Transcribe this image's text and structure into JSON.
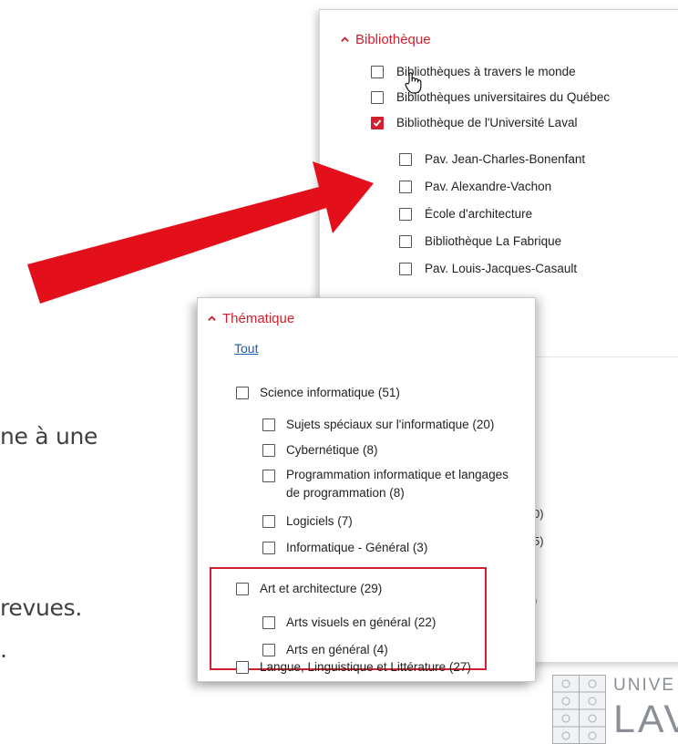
{
  "background_text": {
    "line1": "ne à une",
    "line2": "revues.",
    "line3": "."
  },
  "bibliotheque": {
    "title": "Bibliothèque",
    "items": [
      {
        "label": "Bibliothèques à travers le monde",
        "checked": false
      },
      {
        "label": "Bibliothèques universitaires du Québec",
        "checked": false
      },
      {
        "label": "Bibliothèque de l'Université Laval",
        "checked": true
      }
    ],
    "subitems": [
      {
        "label": "Pav. Jean-Charles-Bonenfant",
        "checked": false
      },
      {
        "label": "Pav. Alexandre-Vachon",
        "checked": false
      },
      {
        "label": "École d'architecture",
        "checked": false
      },
      {
        "label": "Bibliothèque La Fabrique",
        "checked": false
      },
      {
        "label": "Pav. Louis-Jacques-Casault",
        "checked": false
      }
    ],
    "hidden_counts": [
      "0)",
      "5)",
      ")"
    ]
  },
  "thematique": {
    "title": "Thématique",
    "all_link": "Tout",
    "groups": [
      {
        "label": "Science informatique (51)",
        "children": [
          "Sujets spéciaux sur l'informatique (20)",
          "Cybernétique (8)",
          "Programmation informatique et langages de programmation (8)",
          "Logiciels (7)",
          "Informatique - Général (3)"
        ]
      },
      {
        "label": "Art et architecture (29)",
        "children": [
          "Arts visuels en général (22)",
          "Arts en général (4)"
        ]
      },
      {
        "label": "Langue, Linguistique et Littérature (27)",
        "children": []
      }
    ]
  },
  "logo": {
    "line1": "UNIVE",
    "line2": "LAV"
  },
  "colors": {
    "accent_red": "#d11f2f",
    "link_blue": "#1a5bb0",
    "arrow_red": "#e3101c",
    "logo_gray": "#8a8f96"
  }
}
